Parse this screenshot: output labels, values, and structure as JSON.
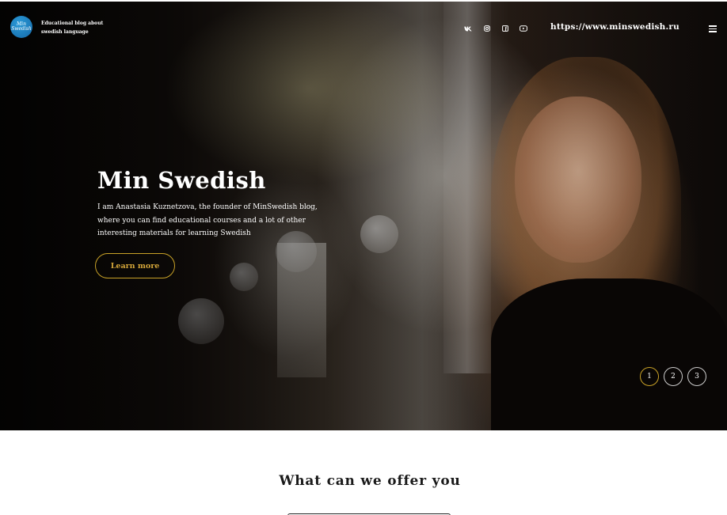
{
  "header": {
    "logo_text": "Min Swedish",
    "tagline": "Educational blog about swedish language",
    "site_url": "https://www.minswedish.ru",
    "social": [
      {
        "name": "vk",
        "icon": "vk-icon"
      },
      {
        "name": "instagram",
        "icon": "instagram-icon"
      },
      {
        "name": "facebook",
        "icon": "facebook-icon"
      },
      {
        "name": "youtube",
        "icon": "youtube-icon"
      }
    ]
  },
  "hero": {
    "title": "Min Swedish",
    "description": "I am Anastasia Kuznetzova, the founder of MinSwedish blog, where you can find educational courses and a lot of other interesting materials for learning Swedish",
    "button_label": "Learn more",
    "slides": [
      "1",
      "2",
      "3"
    ],
    "active_slide": 1
  },
  "offer": {
    "title": "What can we offer you"
  },
  "colors": {
    "accent": "#c9a227",
    "logo_blue": "#1e7fc2",
    "text_dark": "#1a1a1a"
  }
}
